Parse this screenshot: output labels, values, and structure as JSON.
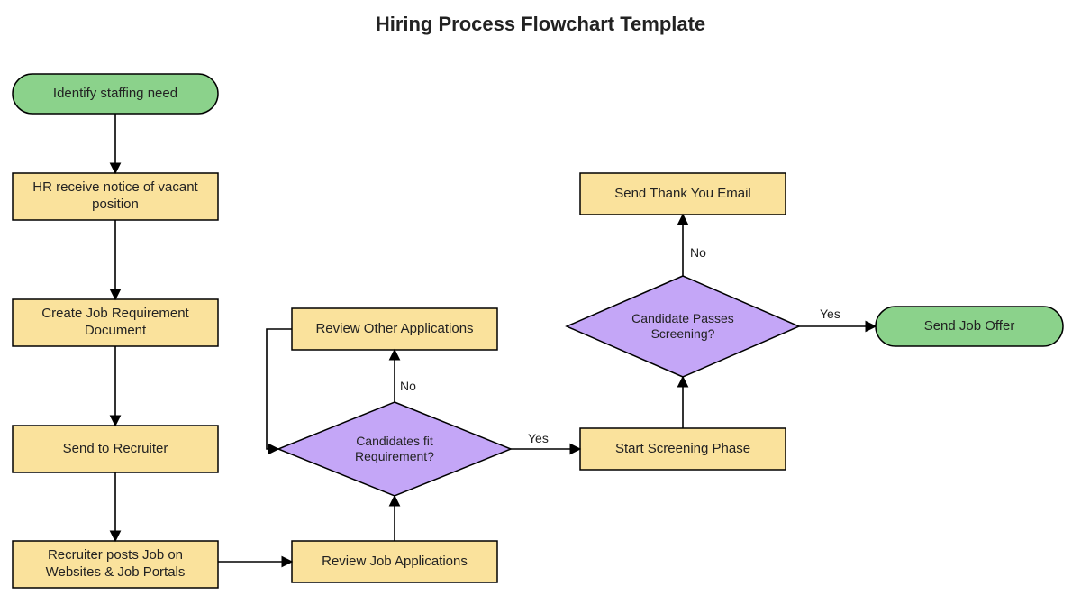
{
  "title": "Hiring Process Flowchart Template",
  "nodes": {
    "n1": {
      "label": "Identify staffing need"
    },
    "n2": {
      "label": "HR receive notice of vacant position"
    },
    "n3": {
      "label": "Create Job Requirement Document"
    },
    "n4": {
      "label": "Send to Recruiter"
    },
    "n5": {
      "label": "Recruiter posts Job on Websites & Job Portals"
    },
    "n6": {
      "label": "Review Job Applications"
    },
    "d1": {
      "label": "Candidates fit Requirement?"
    },
    "n7": {
      "label": "Review Other Applications"
    },
    "n8": {
      "label": "Start Screening Phase"
    },
    "d2": {
      "label": "Candidate Passes Screening?"
    },
    "n9": {
      "label": "Send Thank You Email"
    },
    "n10": {
      "label": "Send Job Offer"
    }
  },
  "edge_labels": {
    "d1_no": "No",
    "d1_yes": "Yes",
    "d2_no": "No",
    "d2_yes": "Yes"
  },
  "colors": {
    "terminator_fill": "#8BD28B",
    "process_fill": "#FAE29C",
    "decision_fill": "#C4A6F7",
    "stroke": "#000000"
  },
  "chart_data": {
    "type": "flowchart",
    "title": "Hiring Process Flowchart Template",
    "nodes": [
      {
        "id": "n1",
        "type": "terminator",
        "label": "Identify staffing need"
      },
      {
        "id": "n2",
        "type": "process",
        "label": "HR receive notice of vacant position"
      },
      {
        "id": "n3",
        "type": "process",
        "label": "Create Job Requirement Document"
      },
      {
        "id": "n4",
        "type": "process",
        "label": "Send to Recruiter"
      },
      {
        "id": "n5",
        "type": "process",
        "label": "Recruiter posts Job on Websites & Job Portals"
      },
      {
        "id": "n6",
        "type": "process",
        "label": "Review Job Applications"
      },
      {
        "id": "d1",
        "type": "decision",
        "label": "Candidates fit Requirement?"
      },
      {
        "id": "n7",
        "type": "process",
        "label": "Review Other Applications"
      },
      {
        "id": "n8",
        "type": "process",
        "label": "Start Screening Phase"
      },
      {
        "id": "d2",
        "type": "decision",
        "label": "Candidate Passes Screening?"
      },
      {
        "id": "n9",
        "type": "process",
        "label": "Send Thank You Email"
      },
      {
        "id": "n10",
        "type": "terminator",
        "label": "Send Job Offer"
      }
    ],
    "edges": [
      {
        "from": "n1",
        "to": "n2"
      },
      {
        "from": "n2",
        "to": "n3"
      },
      {
        "from": "n3",
        "to": "n4"
      },
      {
        "from": "n4",
        "to": "n5"
      },
      {
        "from": "n5",
        "to": "n6"
      },
      {
        "from": "n6",
        "to": "d1"
      },
      {
        "from": "d1",
        "to": "n7",
        "label": "No"
      },
      {
        "from": "n7",
        "to": "d1"
      },
      {
        "from": "d1",
        "to": "n8",
        "label": "Yes"
      },
      {
        "from": "n8",
        "to": "d2"
      },
      {
        "from": "d2",
        "to": "n9",
        "label": "No"
      },
      {
        "from": "d2",
        "to": "n10",
        "label": "Yes"
      }
    ]
  }
}
